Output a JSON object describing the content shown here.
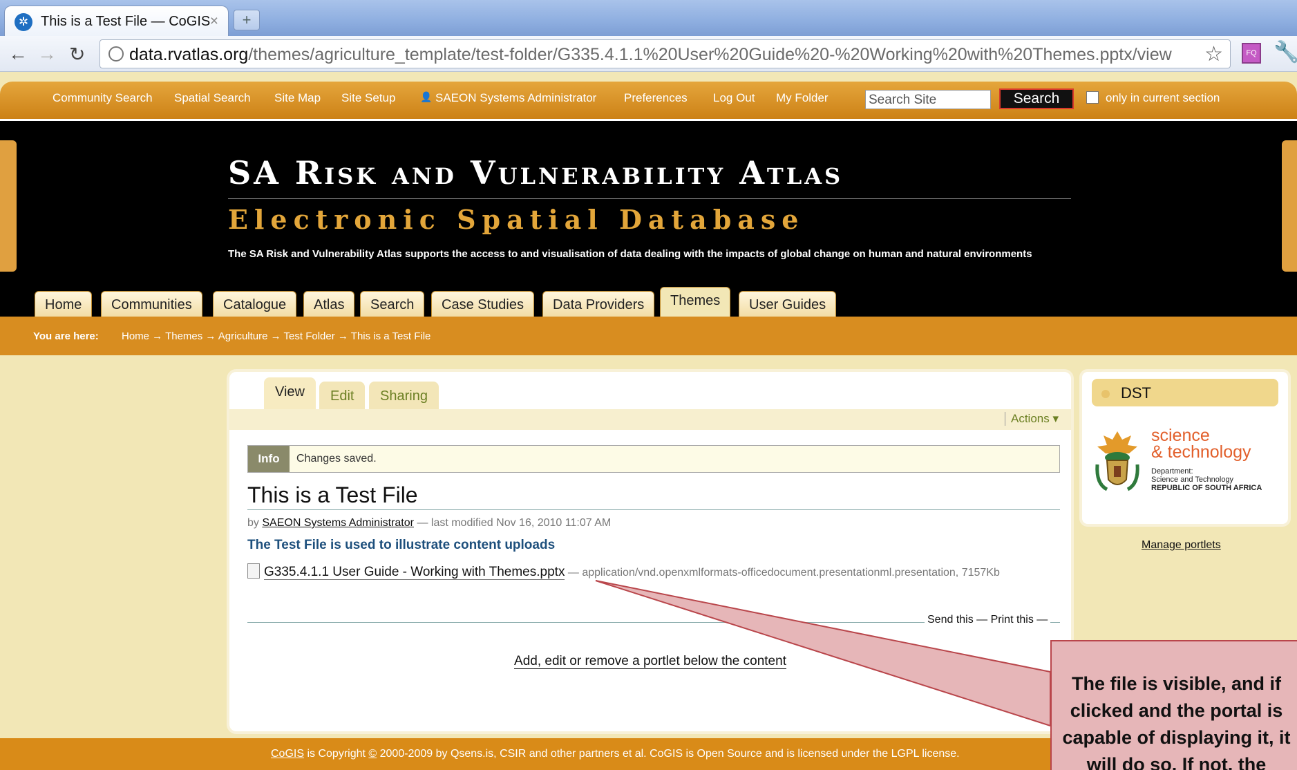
{
  "browser": {
    "tab_title": "This is a Test File — CoGIS",
    "tab_close": "×",
    "new_tab": "+",
    "url_host": "data.rvatlas.org",
    "url_path": "/themes/agriculture_template/test-folder/G335.4.1.1%20User%20Guide%20-%20Working%20with%20Themes.pptx/view"
  },
  "topbar": {
    "links": [
      "Community Search",
      "Spatial Search",
      "Site Map",
      "Site Setup",
      "SAEON Systems Administrator",
      "Preferences",
      "Log Out",
      "My Folder"
    ],
    "search_placeholder": "Search Site",
    "search_button": "Search",
    "only_current": "only in current section"
  },
  "banner": {
    "title": "SA Risk and Vulnerability Atlas",
    "subtitle": "Electronic Spatial Database",
    "description": "The SA Risk and Vulnerability Atlas supports the access to and visualisation of data dealing with the impacts of global change on human and natural environments"
  },
  "nav": {
    "tabs": [
      "Home",
      "Communities",
      "Catalogue",
      "Atlas",
      "Search",
      "Case Studies",
      "Data Providers",
      "Themes",
      "User Guides"
    ],
    "active": "Themes"
  },
  "breadcrumb": {
    "label": "You are here:",
    "trail": "Home → Themes → Agriculture → Test Folder → This is a Test File"
  },
  "content": {
    "tabs": [
      "View",
      "Edit",
      "Sharing"
    ],
    "actions": "Actions ▾",
    "info_label": "Info",
    "info_text": "Changes saved.",
    "title": "This is a Test File",
    "by": "by",
    "author": "SAEON Systems Administrator",
    "modified": "— last modified Nov 16, 2010 11:07 AM",
    "description": "The Test File is used to illustrate content uploads",
    "file_name": "G335.4.1.1 User Guide - Working with Themes.pptx",
    "file_meta": "— application/vnd.openxmlformats-officedocument.presentationml.presentation, 7157Kb",
    "send_this": "Send this",
    "print_this": "Print this",
    "add_portlet": "Add, edit or remove a portlet below the content"
  },
  "portlet": {
    "title": "DST",
    "logo_line1": "science",
    "logo_line2": "& technology",
    "dept_1": "Department:",
    "dept_2": "Science and Technology",
    "dept_3": "REPUBLIC OF SOUTH AFRICA",
    "manage": "Manage portlets"
  },
  "footer": {
    "cogis": "CoGIS",
    "text_a": " is Copyright ",
    "copyright_symbol": "©",
    "text_b": " 2000-2009 by Qsens.is, CSIR and other partners et al. CoGIS is Open Source and is licensed under the LGPL license."
  },
  "callout": {
    "text": "The file is visible, and if clicked and the portal is capable of displaying it, it will do so. If not, the"
  },
  "colors": {
    "orange": "#d88d20",
    "callout_fill": "#e6b6b8",
    "callout_stroke": "#b9464b",
    "link_green": "#6b7f22",
    "heading_blue": "#1d4f7c"
  }
}
